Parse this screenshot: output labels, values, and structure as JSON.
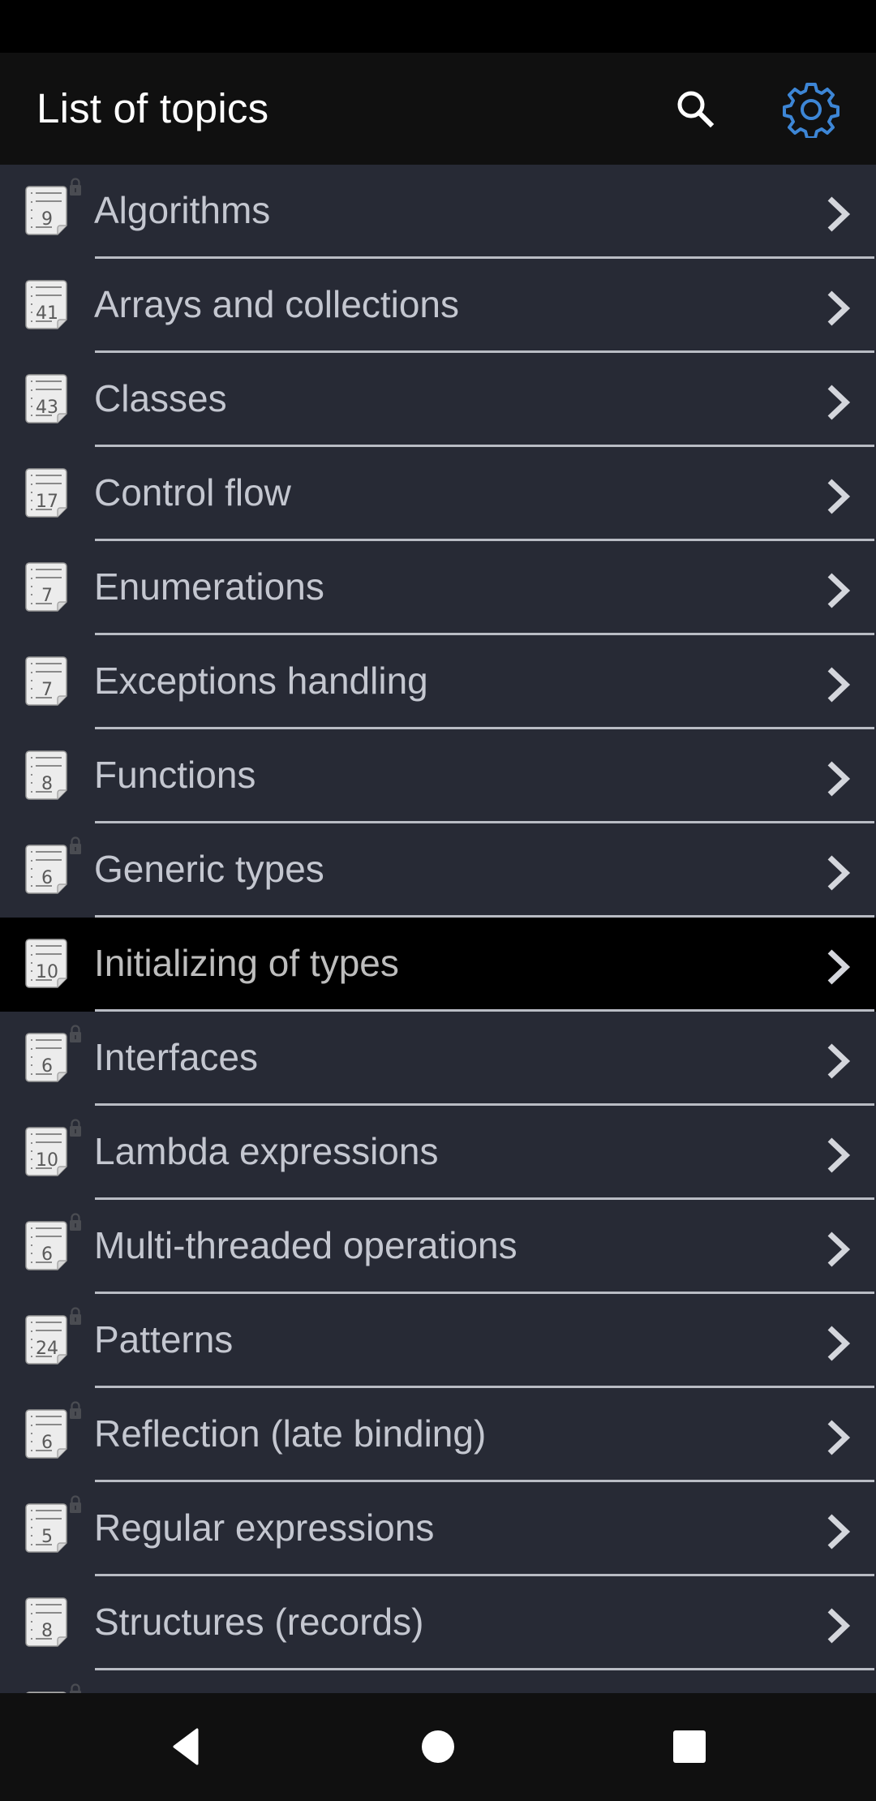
{
  "app_bar": {
    "title": "List of topics",
    "search_icon": "search-icon",
    "settings_icon": "gear-icon",
    "settings_color": "#3d86d6"
  },
  "topics": [
    {
      "label": "Algorithms",
      "count": "9",
      "locked": true,
      "selected": false
    },
    {
      "label": "Arrays and collections",
      "count": "41",
      "locked": false,
      "selected": false
    },
    {
      "label": "Classes",
      "count": "43",
      "locked": false,
      "selected": false
    },
    {
      "label": "Control flow",
      "count": "17",
      "locked": false,
      "selected": false
    },
    {
      "label": "Enumerations",
      "count": "7",
      "locked": false,
      "selected": false
    },
    {
      "label": "Exceptions handling",
      "count": "7",
      "locked": false,
      "selected": false
    },
    {
      "label": "Functions",
      "count": "8",
      "locked": false,
      "selected": false
    },
    {
      "label": "Generic types",
      "count": "6",
      "locked": true,
      "selected": false
    },
    {
      "label": "Initializing of types",
      "count": "10",
      "locked": false,
      "selected": true
    },
    {
      "label": "Interfaces",
      "count": "6",
      "locked": true,
      "selected": false
    },
    {
      "label": "Lambda expressions",
      "count": "10",
      "locked": true,
      "selected": false
    },
    {
      "label": "Multi-threaded operations",
      "count": "6",
      "locked": true,
      "selected": false
    },
    {
      "label": "Patterns",
      "count": "24",
      "locked": true,
      "selected": false
    },
    {
      "label": "Reflection (late binding)",
      "count": "6",
      "locked": true,
      "selected": false
    },
    {
      "label": "Regular expressions",
      "count": "5",
      "locked": true,
      "selected": false
    },
    {
      "label": "Structures (records)",
      "count": "8",
      "locked": false,
      "selected": false
    },
    {
      "label": "",
      "count": "",
      "locked": true,
      "selected": false
    }
  ],
  "row_icons": {
    "document": "document-count-icon",
    "lock": "lock-icon",
    "chevron": "chevron-right-icon"
  },
  "nav_bar": {
    "back": "back-icon",
    "home": "home-icon",
    "recents": "recents-icon"
  },
  "colors": {
    "list_background": "#272a35",
    "selected_background": "#000000",
    "text": "#c4c7d0",
    "separator": "#b9bcc4",
    "accent": "#3d86d6"
  }
}
